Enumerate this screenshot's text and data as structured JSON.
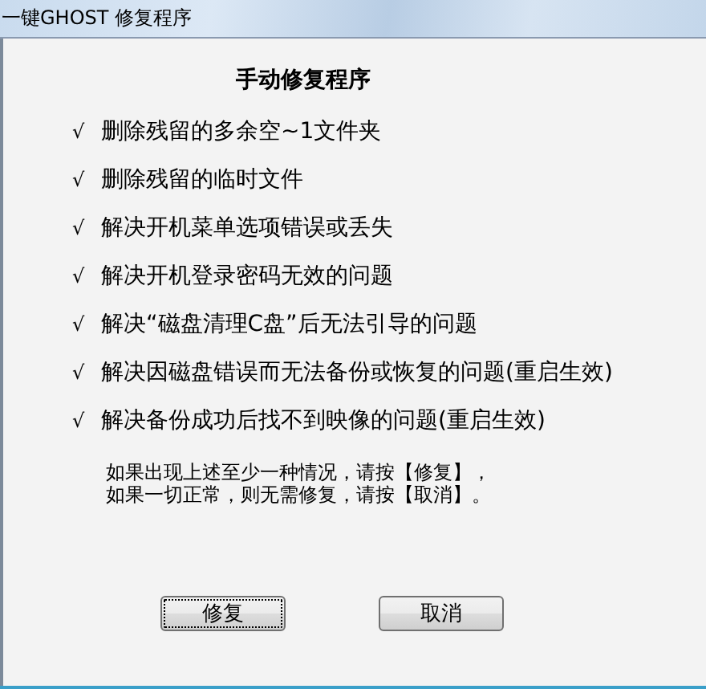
{
  "window": {
    "title": "一键GHOST 修复程序"
  },
  "heading": "手动修复程序",
  "items": [
    {
      "mark": "√",
      "text": "删除残留的多余空~1文件夹"
    },
    {
      "mark": "√",
      "text": "删除残留的临时文件"
    },
    {
      "mark": "√",
      "text": "解决开机菜单选项错误或丢失"
    },
    {
      "mark": "√",
      "text": "解决开机登录密码无效的问题"
    },
    {
      "mark": "√",
      "text": "解决“磁盘清理C盘”后无法引导的问题"
    },
    {
      "mark": "√",
      "text": "解决因磁盘错误而无法备份或恢复的问题(重启生效)"
    },
    {
      "mark": "√",
      "text": "解决备份成功后找不到映像的问题(重启生效)"
    }
  ],
  "note": [
    "如果出现上述至少一种情况，请按【修复】，",
    "如果一切正常，则无需修复，请按【取消】。"
  ],
  "buttons": [
    {
      "label": "修复",
      "focused": true
    },
    {
      "label": "取消",
      "focused": false
    }
  ]
}
